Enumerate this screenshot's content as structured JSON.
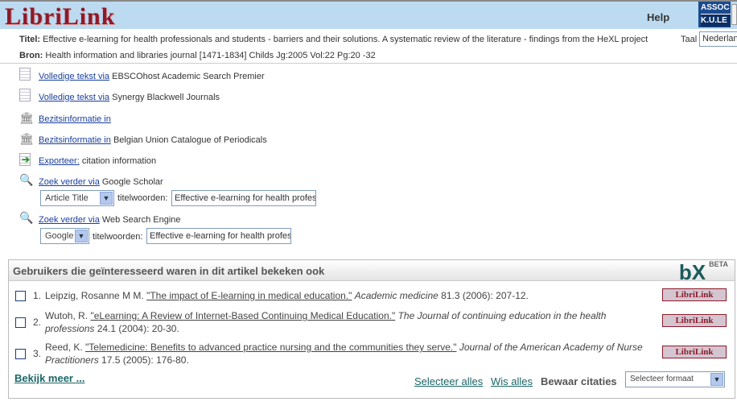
{
  "header": {
    "logo": "LibriLink",
    "help": "Help",
    "assoc_line1": "ASSOC",
    "assoc_line2": "K.U.LE"
  },
  "meta": {
    "title_label": "Titel:",
    "title": "Effective e-learning for health professionals and students - barriers and their solutions. A systematic review of the literature - findings from the HeXL project",
    "source_label": "Bron:",
    "source": "Health information and libraries journal [1471-1834] Childs Jg:2005 Vol:22 Pg:20 -32",
    "language_label": "Taal",
    "language": "Nederlands"
  },
  "links": [
    {
      "icon": "document-icon",
      "link": "Volledige tekst via",
      "text": "EBSCOhost Academic Search Premier"
    },
    {
      "icon": "document-icon",
      "link": "Volledige tekst via",
      "text": "Synergy Blackwell Journals"
    },
    {
      "icon": "library-icon",
      "link": "Bezitsinformatie in",
      "text": ""
    },
    {
      "icon": "library-icon",
      "link": "Bezitsinformatie in",
      "text": "Belgian Union Catalogue of Periodicals"
    },
    {
      "icon": "export-icon",
      "link": "Exporteer:",
      "text": "citation information"
    },
    {
      "icon": "search-icon",
      "link": "Zoek verder via",
      "text": "Google Scholar"
    },
    {
      "icon": "search-icon",
      "link": "Zoek verder via",
      "text": "Web Search Engine"
    }
  ],
  "search1": {
    "select": "Article Title",
    "label": "titelwoorden:",
    "value": "Effective e-learning for health profes"
  },
  "search2": {
    "select": "Google",
    "label": "titelwoorden:",
    "value": "Effective e-learning for health profes"
  },
  "bx": {
    "heading": "Gebruikers die geïnteresseerd waren in dit artikel bekeken ook",
    "logo": "bX",
    "beta": "BETA",
    "items": [
      {
        "num": "1.",
        "author": "Leipzig, Rosanne M M.",
        "title": "\"The impact of E-learning in medical education.\"",
        "journal": "Academic medicine",
        "rest": "81.3 (2006): 207-12.",
        "button": "LibriLink"
      },
      {
        "num": "2.",
        "author": "Wutoh, R.",
        "title": "\"eLearning: A Review of Internet-Based Continuing Medical Education.\"",
        "journal": "The Journal of continuing education in the health professions",
        "rest": "24.1 (2004): 20-30.",
        "button": "LibriLink"
      },
      {
        "num": "3.",
        "author": "Reed, K.",
        "title": "\"Telemedicine: Benefits to advanced practice nursing and the communities they serve.\"",
        "journal": "Journal of the American Academy of Nurse Practitioners",
        "rest": "17.5 (2005): 176-80.",
        "button": "LibriLink"
      }
    ],
    "more": "Bekijk meer ...",
    "select_all": "Selecteer alles",
    "clear_all": "Wis alles",
    "save_label": "Bewaar citaties",
    "format": "Selecteer formaat"
  }
}
